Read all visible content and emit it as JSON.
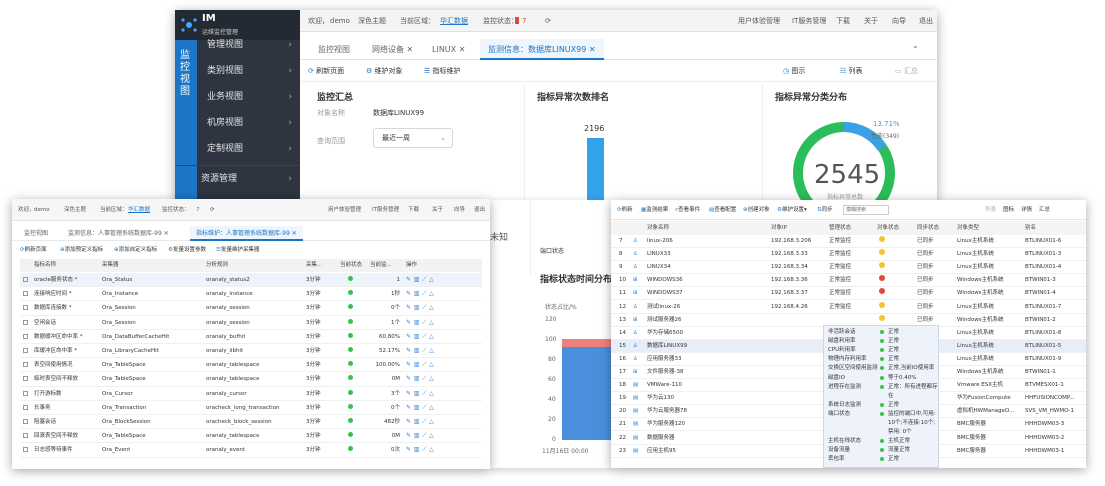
{
  "main": {
    "app_name": "IM",
    "app_sub": "运维监控管理",
    "rail_label": [
      "监",
      "控",
      "视",
      "图"
    ],
    "sidebar": [
      "管理视图",
      "类别视图",
      "业务视图",
      "机房视图",
      "定制视图",
      "资源管理"
    ],
    "topbar": {
      "welcome": "欢迎，",
      "user": "demo",
      "theme": "深色主题",
      "area_label": "当前区域：",
      "area": "华汇数据",
      "status_label": "监控状态：",
      "status_count": "7",
      "links": [
        "用户体验管理",
        "IT服务管理",
        "下载",
        "关于",
        "向导",
        "退出"
      ]
    },
    "tabs": [
      "监控视图",
      "网络设备",
      "LINUX",
      "监测信息：数据库LINUX99"
    ],
    "toolbar": [
      "刷新页面",
      "维护对象",
      "指标维护"
    ],
    "view_buttons": [
      "图示",
      "列表",
      "汇总"
    ],
    "summary": {
      "title": "监控汇总",
      "obj_label": "对象名称",
      "obj_value": "数据库LINUX99",
      "range_label": "查询范围",
      "range_value": "最近一周"
    },
    "rank": {
      "title": "指标异常次数排名",
      "value": "2196",
      "bar_label": "端口状态",
      "side_label": "未知"
    },
    "dist": {
      "title": "指标异常分类分布",
      "pct": "13.71%",
      "pct_sub": "性能(349)",
      "total": "2545",
      "total_label": "指标异常总数"
    },
    "time": {
      "title": "指标状态时间分布",
      "ylabel": "状态占比/%",
      "yticks": [
        "120",
        "100",
        "80",
        "60",
        "40",
        "20",
        "0"
      ],
      "xlabel": "11月16日 00:00"
    }
  },
  "left": {
    "topbar": {
      "welcome": "欢迎，",
      "user": "demo",
      "theme": "深色主题",
      "area_label": "当前区域：",
      "area": "华汇数据",
      "status_label": "监控状态：",
      "status_count": "7",
      "links": [
        "用户体验管理",
        "IT服务管理",
        "下载",
        "关于",
        "向导",
        "退出"
      ]
    },
    "tabs": [
      "监控视图",
      "监测信息：人事管理系统数据库-99",
      "指标维护：人事管理系统数据库-99"
    ],
    "toolbar": [
      "刷新页面",
      "添加预定义指标",
      "添加自定义指标",
      "批量设置参数",
      "批量维护采集器"
    ],
    "columns": [
      "指标名称",
      "采集器",
      "分析规则",
      "采集...",
      "当前状态",
      "当前监...",
      "操作"
    ],
    "rows": [
      [
        "oracle服务状态 *",
        "Ora_Status",
        "oranaly_status2",
        "3分钟",
        "1"
      ],
      [
        "连接响应时间 *",
        "Ora_Instance",
        "oranaly_instance",
        "3分钟",
        "1秒"
      ],
      [
        "数据库连接数 *",
        "Ora_Session",
        "oranaly_session",
        "3分钟",
        "0个"
      ],
      [
        "空闲会话",
        "Ora_Session",
        "oranaly_session",
        "3分钟",
        "1个"
      ],
      [
        "数据缓冲区命中率 *",
        "Ora_DataBufferCacheHit",
        "oranaly_bufhit",
        "3分钟",
        "60.80%"
      ],
      [
        "库缓冲区命中率 *",
        "Ora_LibraryCacheHit",
        "oranaly_libhit",
        "3分钟",
        "52.17%"
      ],
      [
        "表空间使用情况",
        "Ora_TableSpace",
        "oranaly_tablespace",
        "3分钟",
        "100.00%"
      ],
      [
        "临时表空间不释放",
        "Ora_TableSpace",
        "oranaly_tablespace",
        "3分钟",
        "0M"
      ],
      [
        "打开游标数",
        "Ora_Cursor",
        "oranaly_cursor",
        "3分钟",
        "3个"
      ],
      [
        "长事务",
        "Ora_Transaction",
        "oracheck_long_transaction",
        "3分钟",
        "0个"
      ],
      [
        "阻塞会话",
        "Ora_BlockSession",
        "oracheck_block_session",
        "3分钟",
        "482秒"
      ],
      [
        "回滚表空间不释放",
        "Ora_TableSpace",
        "oranaly_tablespace",
        "3分钟",
        "0M"
      ],
      [
        "日志感等待事件",
        "Ora_Event",
        "oranaly_event",
        "3分钟",
        "0次"
      ]
    ]
  },
  "right": {
    "toolbar": [
      "刷新",
      "监测结果",
      "查看事件",
      "查看配置",
      "创建对象",
      "维护设置",
      "同步"
    ],
    "search_placeholder": "模糊搜索",
    "views": [
      "列表",
      "图标",
      "详情",
      "汇总"
    ],
    "columns": [
      "对象名称",
      "对象IP",
      "管理状态",
      "对象状态",
      "同步状态",
      "对象类型",
      "别名"
    ],
    "rows": [
      [
        "7",
        "linux-206",
        "192.168.3.206",
        "正常监控",
        "yellow",
        "已同步",
        "Linux主机系统",
        "BTLINUX01-6"
      ],
      [
        "8",
        "LINUX33",
        "192.168.3.33",
        "正常监控",
        "yellow",
        "已同步",
        "Linux主机系统",
        "BTLINUX01-3"
      ],
      [
        "9",
        "LINUX34",
        "192.168.3.34",
        "正常监控",
        "yellow",
        "已同步",
        "Linux主机系统",
        "BTLINUX01-4"
      ],
      [
        "10",
        "WINDOWS36",
        "192.168.3.36",
        "正常监控",
        "red",
        "已同步",
        "Windows主机系统",
        "BTWIN01-3"
      ],
      [
        "11",
        "WINDOWS37",
        "192.168.3.37",
        "正常监控",
        "red",
        "已同步",
        "Windows主机系统",
        "BTWIN01-4"
      ],
      [
        "12",
        "测试linux-26",
        "192.168.4.26",
        "正常监控",
        "yellow",
        "已同步",
        "Linux主机系统",
        "BTLINUX01-7"
      ],
      [
        "13",
        "测试服务器26",
        "",
        "",
        "yellow",
        "已同步",
        "Windows主机系统",
        "BTWIN01-2"
      ],
      [
        "14",
        "华为存储6500",
        "",
        "",
        "yellow",
        "已同步",
        "Linux主机系统",
        "BTLINUX01-8"
      ],
      [
        "15",
        "数据库LINUX99",
        "",
        "",
        "yellow",
        "已同步",
        "Linux主机系统",
        "BTLINUX01-5"
      ],
      [
        "16",
        "应用服务器33",
        "",
        "",
        "yellow",
        "已同步",
        "Linux主机系统",
        "BTLINUX01-9"
      ],
      [
        "17",
        "文件服务器-38",
        "",
        "",
        "yellow",
        "已同步",
        "Windows主机系统",
        "BTWIN01-1"
      ],
      [
        "18",
        "VMWare-110",
        "",
        "",
        "yellow",
        "已同步",
        "Vmware ESX主机",
        "BTVMESX01-1"
      ],
      [
        "19",
        "华为云130",
        "",
        "",
        "yellow",
        "已同步",
        "华为FusionCompute",
        "HHFUSIONCOMP..."
      ],
      [
        "20",
        "华为云服务器78",
        "",
        "",
        "yellow",
        "已同步",
        "虚拟机HWManageO...",
        "SVS_VM_HWMO-1"
      ],
      [
        "21",
        "华为服务器120",
        "",
        "",
        "yellow",
        "已同步",
        "BMC服务器",
        "HHHDWM03-3"
      ],
      [
        "22",
        "数据服务器",
        "",
        "",
        "yellow",
        "已同步",
        "BMC服务器",
        "HHHDWM03-2"
      ],
      [
        "23",
        "应用主机95",
        "",
        "",
        "",
        "已同步",
        "BMC服务器",
        "HHHDWM03-1"
      ]
    ],
    "tooltip": [
      [
        "非活跃会话",
        "正常"
      ],
      [
        "磁盘利用率",
        "正常"
      ],
      [
        "CPU利用率",
        "正常"
      ],
      [
        "物理内存利用率",
        "正常"
      ],
      [
        "交换区空间使用监测",
        "正常,当前IO使用率"
      ],
      [
        "磁盘IO",
        "等于0.40%"
      ],
      [
        "进程存在监测",
        "正常：所有进程都存"
      ],
      [
        "",
        "在"
      ],
      [
        "系统日志监测",
        "正常"
      ],
      [
        "端口状态",
        "监控的端口中,可用:"
      ],
      [
        "",
        "10个;不连接:10个;"
      ],
      [
        "",
        "禁用: 0个"
      ],
      [
        "主机在线状态",
        "主机正常"
      ],
      [
        "设备流量",
        "流量正常"
      ],
      [
        "丢包率",
        "正常"
      ]
    ]
  },
  "colors": {
    "accent": "#1d75c7",
    "ok": "#3cc04a",
    "warn": "#f5c431",
    "bad": "#e2473b",
    "ring": "#2bbd5a",
    "ring_part": "#3aa0e8"
  }
}
